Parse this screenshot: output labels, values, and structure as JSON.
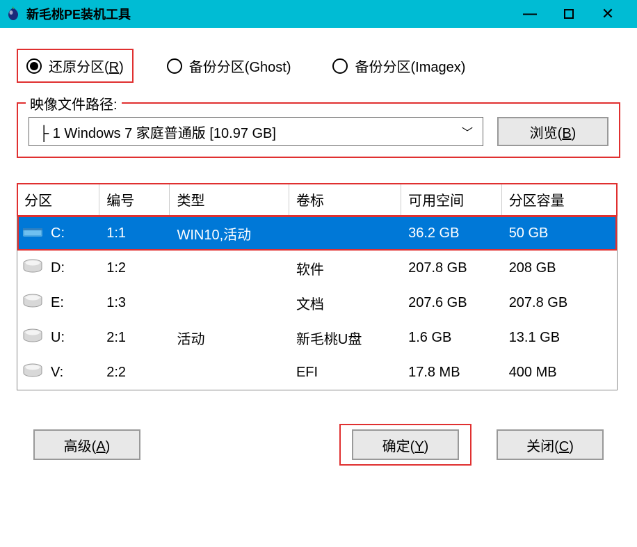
{
  "titlebar": {
    "title": "新毛桃PE装机工具"
  },
  "radios": {
    "restore": "还原分区(R)",
    "backup_ghost": "备份分区(Ghost)",
    "backup_imagex": "备份分区(Imagex)"
  },
  "image_path": {
    "label": "映像文件路径:",
    "selected": "├ 1 Windows 7 家庭普通版 [10.97 GB]",
    "browse": "浏览(B)"
  },
  "table": {
    "headers": {
      "partition": "分区",
      "number": "编号",
      "type": "类型",
      "label": "卷标",
      "free": "可用空间",
      "capacity": "分区容量"
    },
    "rows": [
      {
        "drive": "C:",
        "num": "1:1",
        "type": "WIN10,活动",
        "label": "",
        "free": "36.2 GB",
        "cap": "50 GB",
        "selected": true,
        "icon": "special"
      },
      {
        "drive": "D:",
        "num": "1:2",
        "type": "",
        "label": "软件",
        "free": "207.8 GB",
        "cap": "208 GB",
        "selected": false,
        "icon": "hdd"
      },
      {
        "drive": "E:",
        "num": "1:3",
        "type": "",
        "label": "文档",
        "free": "207.6 GB",
        "cap": "207.8 GB",
        "selected": false,
        "icon": "hdd"
      },
      {
        "drive": "U:",
        "num": "2:1",
        "type": "活动",
        "label": "新毛桃U盘",
        "free": "1.6 GB",
        "cap": "13.1 GB",
        "selected": false,
        "icon": "hdd"
      },
      {
        "drive": "V:",
        "num": "2:2",
        "type": "",
        "label": "EFI",
        "free": "17.8 MB",
        "cap": "400 MB",
        "selected": false,
        "icon": "hdd"
      }
    ]
  },
  "footer": {
    "advanced": "高级(A)",
    "ok": "确定(Y)",
    "close": "关闭(C)"
  }
}
